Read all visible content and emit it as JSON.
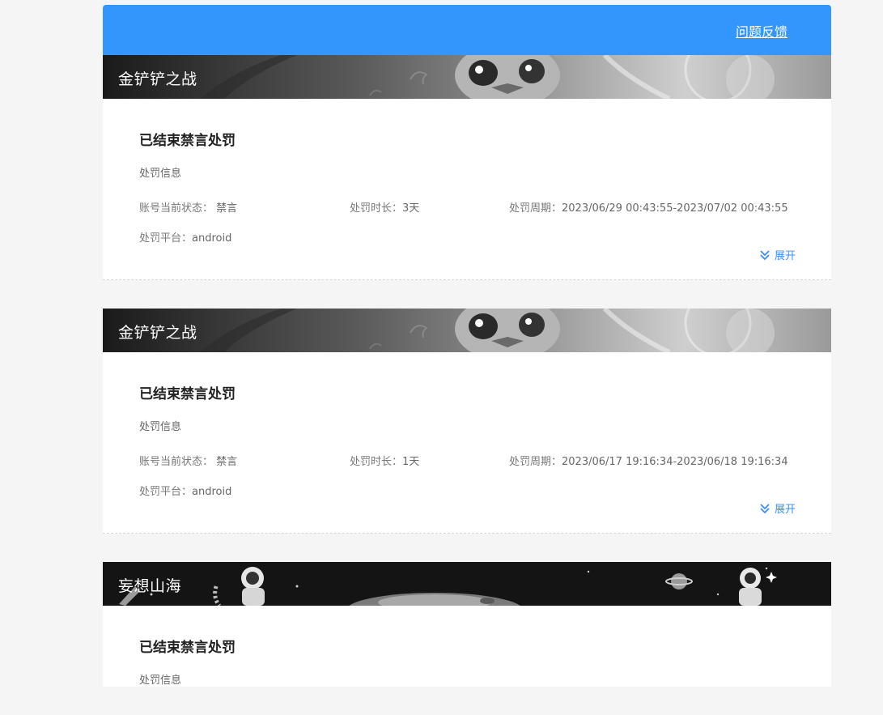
{
  "header": {
    "feedback_label": "问题反馈",
    "color": "#3396fc"
  },
  "labels": {
    "status_title": "已结束禁言处罚",
    "section": "处罚信息",
    "account_status_label": "账号当前状态：",
    "duration_label": "处罚时长：",
    "period_label": "处罚周期：",
    "platform_label": "处罚平台：",
    "expand": "展开"
  },
  "records": [
    {
      "game": "金铲铲之战",
      "banner_icon": "game-banner-penguin-art",
      "status": "禁言",
      "duration": "3天",
      "period": "2023/06/29 00:43:55-2023/07/02 00:43:55",
      "platform": "android"
    },
    {
      "game": "金铲铲之战",
      "banner_icon": "game-banner-penguin-art",
      "status": "禁言",
      "duration": "1天",
      "period": "2023/06/17 19:16:34-2023/06/18 19:16:34",
      "platform": "android"
    },
    {
      "game": "妄想山海",
      "banner_icon": "game-banner-astronaut-art",
      "section_visible": "处罚信息"
    }
  ]
}
